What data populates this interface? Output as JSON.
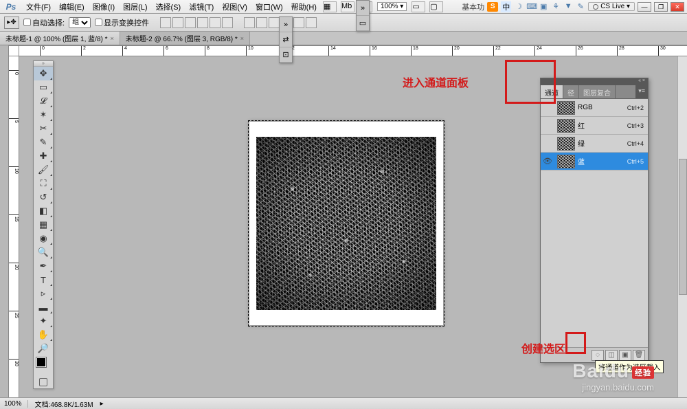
{
  "app": {
    "logo": "Ps"
  },
  "menu": {
    "items": [
      "文件(F)",
      "编辑(E)",
      "图像(I)",
      "图层(L)",
      "选择(S)",
      "滤镜(T)",
      "视图(V)",
      "窗口(W)",
      "帮助(H)"
    ],
    "zoom": "100% ▾",
    "essentials": "基本功",
    "ime": "中",
    "cslive": "CS Live ▾"
  },
  "options": {
    "auto_select": "自动选择:",
    "group": "组",
    "show_transform": "显示变换控件"
  },
  "tabs": [
    "未标题-1 @ 100% (图层 1, 蓝/8) *",
    "未标题-2 @ 66.7% (图层 3, RGB/8) *"
  ],
  "annotations": {
    "enter_channels": "进入通道面板",
    "create_selection": "创建选区",
    "tooltip": "将通道作为选区载入"
  },
  "channels_panel": {
    "tabs": [
      "通道",
      "径",
      "图层复合"
    ],
    "rows": [
      {
        "name": "RGB",
        "shortcut": "Ctrl+2",
        "eye": false,
        "selected": false
      },
      {
        "name": "红",
        "shortcut": "Ctrl+3",
        "eye": false,
        "selected": false
      },
      {
        "name": "绿",
        "shortcut": "Ctrl+4",
        "eye": false,
        "selected": false
      },
      {
        "name": "蓝",
        "shortcut": "Ctrl+5",
        "eye": true,
        "selected": true
      }
    ]
  },
  "statusbar": {
    "zoom": "100%",
    "docinfo": "文档:468.8K/1.63M"
  },
  "watermark": {
    "brand": "Baidu",
    "badge": "经验",
    "url": "jingyan.baidu.com"
  },
  "ruler_ticks": [
    "0",
    "5",
    "10",
    "15",
    "20",
    "25",
    "30"
  ],
  "ruler_major": [
    "0",
    "2",
    "4",
    "6",
    "8",
    "10",
    "12",
    "14",
    "16",
    "18",
    "20",
    "22",
    "24",
    "26",
    "28",
    "30"
  ]
}
